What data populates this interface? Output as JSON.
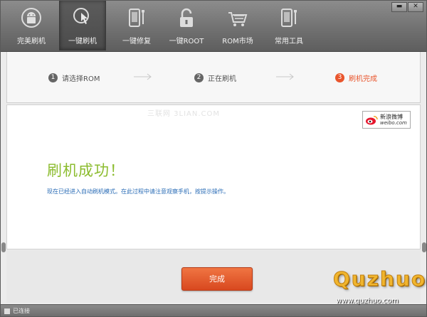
{
  "toolbar": {
    "items": [
      {
        "label": "完美刷机",
        "icon": "android-icon"
      },
      {
        "label": "一键刷机",
        "icon": "touch-flash-icon"
      },
      {
        "label": "一键修复",
        "icon": "phone-repair-icon"
      },
      {
        "label": "一键ROOT",
        "icon": "unlock-icon"
      },
      {
        "label": "ROM市场",
        "icon": "cart-icon"
      },
      {
        "label": "常用工具",
        "icon": "tools-icon"
      }
    ],
    "active_index": 1
  },
  "window_buttons": {
    "minimize": "▬",
    "close": "✕"
  },
  "steps": [
    {
      "num": "1",
      "label": "请选择ROM"
    },
    {
      "num": "2",
      "label": "正在刷机"
    },
    {
      "num": "3",
      "label": "刷机完成"
    }
  ],
  "main": {
    "watermark": "三联网 3LIAN.COM",
    "weibo_cn": "新浪微博",
    "weibo_en": "weibo.com",
    "title": "刷机成功！",
    "description": "现在已经进入自动刷机模式。在此过程中请注意观察手机，按提示操作。"
  },
  "done_button": "完成",
  "status": {
    "connection": "已连接"
  },
  "brand": {
    "name": "Quzhuo",
    "url": "www.quzhuo.com"
  },
  "colors": {
    "accent": "#e9552c",
    "success": "#8cbc2f",
    "link": "#2a6cb6"
  }
}
